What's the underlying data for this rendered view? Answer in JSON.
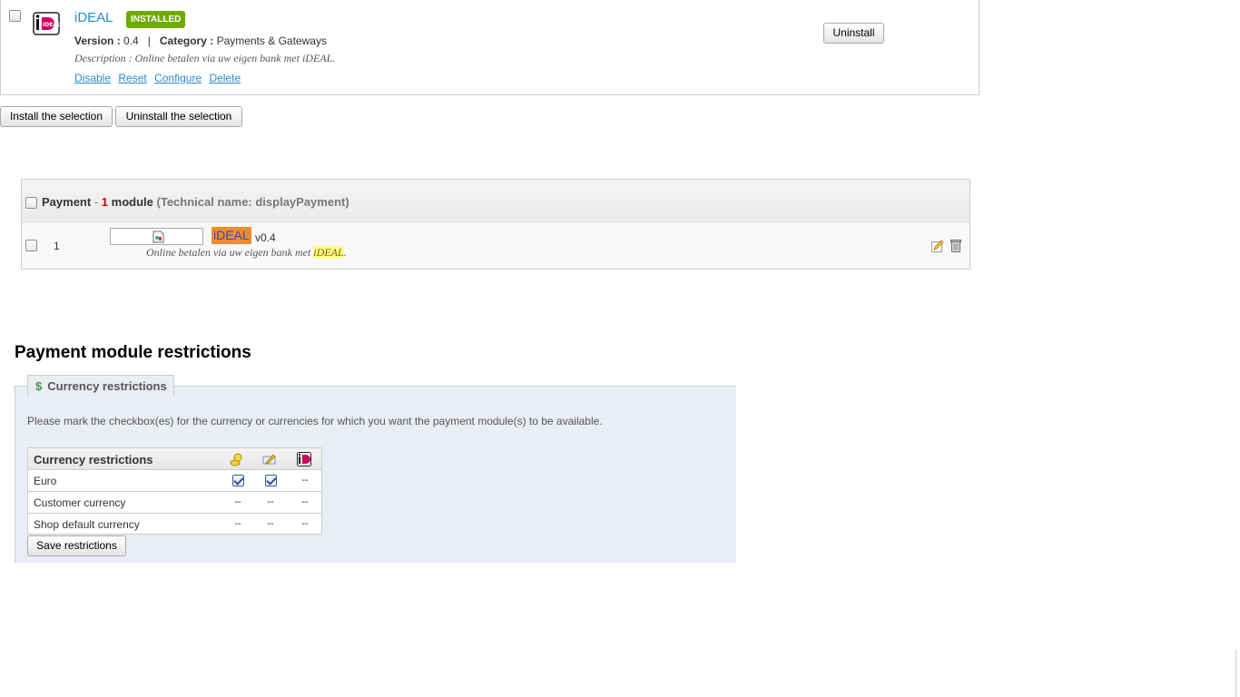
{
  "module": {
    "name": "iDEAL",
    "badge": "INSTALLED",
    "version_label": "Version :",
    "version": "0.4",
    "separator": "|",
    "category_label": "Category :",
    "category": "Payments & Gateways",
    "description": "Description : Online betalen via uw eigen bank met iDEAL.",
    "actions": [
      "Disable",
      "Reset",
      "Configure",
      "Delete"
    ],
    "uninstall_label": "Uninstall"
  },
  "bulk": {
    "install_label": "Install the selection",
    "uninstall_label": "Uninstall the selection"
  },
  "hook": {
    "name": "Payment",
    "dash": "-",
    "count": "1",
    "unit": "module",
    "technical": "(Technical name: displayPayment)",
    "row": {
      "position": "1",
      "module_name": "iDEAL",
      "version": "v0.4",
      "desc_prefix": "Online betalen via uw eigen bank met ",
      "desc_highlight": "iDEAL",
      "desc_suffix": "."
    }
  },
  "restrictions": {
    "title": "Payment module restrictions",
    "legend": "Currency restrictions",
    "help": "Please mark the checkbox(es) for the currency or currencies for which you want the payment module(s) to be available.",
    "table_header": "Currency restrictions",
    "column_icons": [
      "coins-icon",
      "cheque-icon",
      "ideal-logo-icon"
    ],
    "rows": [
      {
        "label": "Euro",
        "c1": "checked",
        "c2": "checked",
        "c3": "--"
      },
      {
        "label": "Customer currency",
        "c1": "--",
        "c2": "--",
        "c3": "--"
      },
      {
        "label": "Shop default currency",
        "c1": "--",
        "c2": "--",
        "c3": "--"
      }
    ],
    "save_label": "Save restrictions"
  },
  "colors": {
    "link": "#268ccd",
    "badge": "#6dab00",
    "highlight_orange": "#f28a32",
    "highlight_yellow": "#ffff88",
    "count_red": "#cc0000"
  }
}
